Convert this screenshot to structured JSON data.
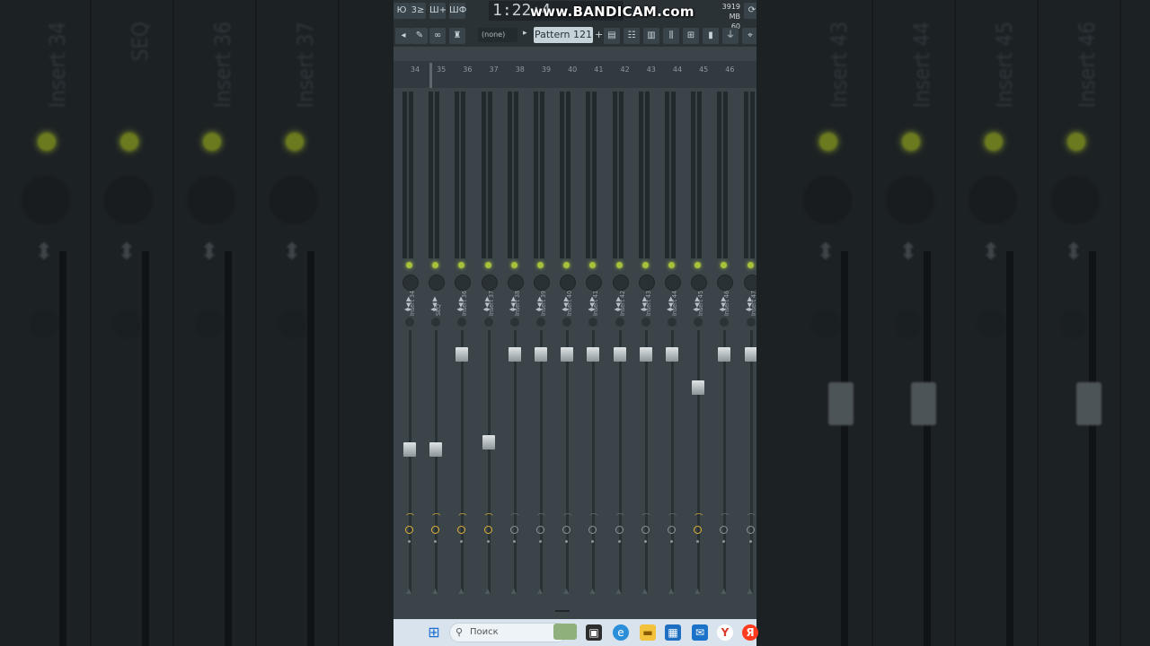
{
  "toolbar": {
    "top_buttons": [
      "Ю",
      "3≥",
      "Ш+",
      "ШФ"
    ],
    "time": "1:22:4",
    "watermark": "www.BANDICAM.com",
    "mem_line1": "3919 MB",
    "mem_line2": "60",
    "selector_value": "(none)",
    "pattern_label": "Pattern 121",
    "pattern_add": "+"
  },
  "mixer": {
    "track_numbers": [
      "34",
      "35",
      "36",
      "37",
      "38",
      "39",
      "40",
      "41",
      "42",
      "43",
      "44",
      "45",
      "46"
    ],
    "strips": [
      {
        "name": "Insert 34",
        "fader_level": 0.55,
        "route_active": true
      },
      {
        "name": "SEQ",
        "fader_level": 0.55,
        "route_active": true
      },
      {
        "name": "Insert 36",
        "fader_level": 0.93,
        "route_active": true
      },
      {
        "name": "Insert 37",
        "fader_level": 0.58,
        "route_active": true
      },
      {
        "name": "Insert 38",
        "fader_level": 0.93,
        "route_active": false
      },
      {
        "name": "Insert 39",
        "fader_level": 0.93,
        "route_active": false
      },
      {
        "name": "Insert 40",
        "fader_level": 0.93,
        "route_active": false
      },
      {
        "name": "Insert 41",
        "fader_level": 0.93,
        "route_active": false
      },
      {
        "name": "Insert 42",
        "fader_level": 0.93,
        "route_active": false
      },
      {
        "name": "Insert 43",
        "fader_level": 0.93,
        "route_active": false
      },
      {
        "name": "Insert 44",
        "fader_level": 0.93,
        "route_active": false
      },
      {
        "name": "Insert 45",
        "fader_level": 0.8,
        "route_active": true
      },
      {
        "name": "Insert 46",
        "fader_level": 0.93,
        "route_active": false
      },
      {
        "name": "Insert 47",
        "fader_level": 0.93,
        "route_active": false
      }
    ]
  },
  "background": {
    "left_labels": [
      "Insert 34",
      "SEQ",
      "Insert 36",
      "Insert 37"
    ],
    "right_labels": [
      "Insert 43",
      "Insert 44",
      "Insert 45",
      "Insert 46"
    ]
  },
  "taskbar": {
    "search_placeholder": "Поиск",
    "apps": [
      "start-icon",
      "search-icon",
      "landscape-widget-icon",
      "task-view-icon",
      "edge-icon",
      "file-explorer-icon",
      "store-icon",
      "mail-icon",
      "yandex-browser-icon",
      "yandex-icon"
    ]
  },
  "colors": {
    "accent_led": "#a7c23a",
    "route_active": "#e0b43a",
    "panel": "#3b4448"
  }
}
